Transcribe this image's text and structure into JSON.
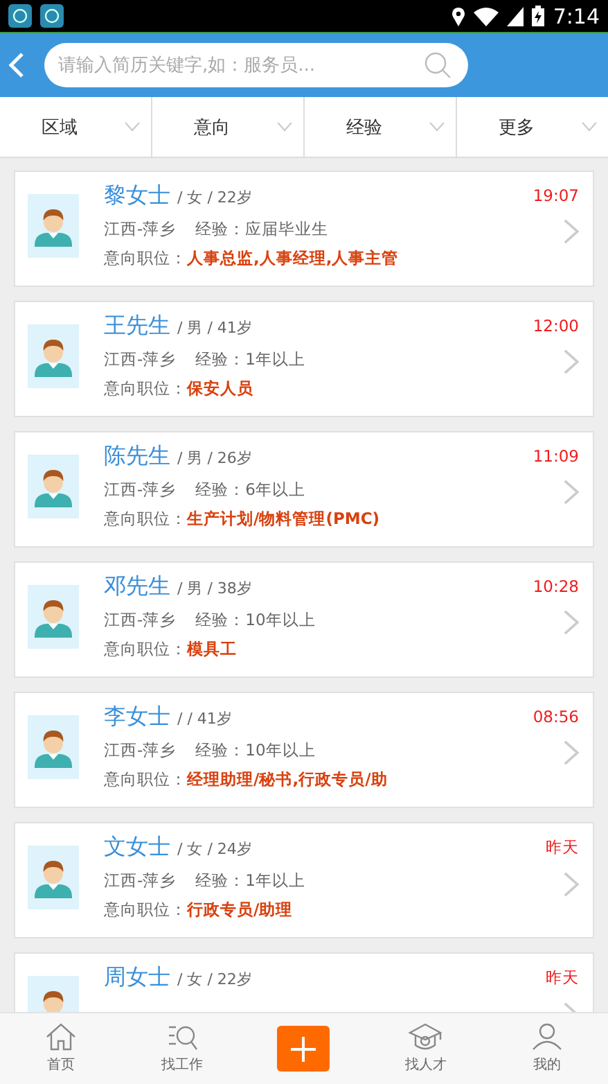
{
  "status_bar": {
    "time": "7:14"
  },
  "search": {
    "placeholder": "请输入简历关键字,如：服务员..."
  },
  "filters": [
    {
      "label": "区域"
    },
    {
      "label": "意向"
    },
    {
      "label": "经验"
    },
    {
      "label": "更多"
    }
  ],
  "resumes": [
    {
      "name": "黎女士",
      "meta": "/ 女 / 22岁",
      "location": "江西-萍乡",
      "experience": "经验：应届毕业生",
      "intent_label": "意向职位：",
      "intent": "人事总监,人事经理,人事主管",
      "time": "19:07"
    },
    {
      "name": "王先生",
      "meta": "/ 男 / 41岁",
      "location": "江西-萍乡",
      "experience": "经验：1年以上",
      "intent_label": "意向职位：",
      "intent": "保安人员",
      "time": "12:00"
    },
    {
      "name": "陈先生",
      "meta": "/ 男 / 26岁",
      "location": "江西-萍乡",
      "experience": "经验：6年以上",
      "intent_label": "意向职位：",
      "intent": "生产计划/物料管理(PMC)",
      "time": "11:09"
    },
    {
      "name": "邓先生",
      "meta": "/ 男 / 38岁",
      "location": "江西-萍乡",
      "experience": "经验：10年以上",
      "intent_label": "意向职位：",
      "intent": "模具工",
      "time": "10:28"
    },
    {
      "name": "李女士",
      "meta": "/ / 41岁",
      "location": "江西-萍乡",
      "experience": "经验：10年以上",
      "intent_label": "意向职位：",
      "intent": "经理助理/秘书,行政专员/助",
      "time": "08:56"
    },
    {
      "name": "文女士",
      "meta": "/ 女 / 24岁",
      "location": "江西-萍乡",
      "experience": "经验：1年以上",
      "intent_label": "意向职位：",
      "intent": "行政专员/助理",
      "time": "昨天"
    },
    {
      "name": "周女士",
      "meta": "/ 女 / 22岁",
      "time": "昨天"
    }
  ],
  "tabbar": [
    {
      "kind": "home",
      "label": "首页"
    },
    {
      "kind": "jobs",
      "label": "找工作"
    },
    {
      "kind": "add"
    },
    {
      "kind": "talent",
      "label": "找人才"
    },
    {
      "kind": "me",
      "label": "我的"
    }
  ]
}
